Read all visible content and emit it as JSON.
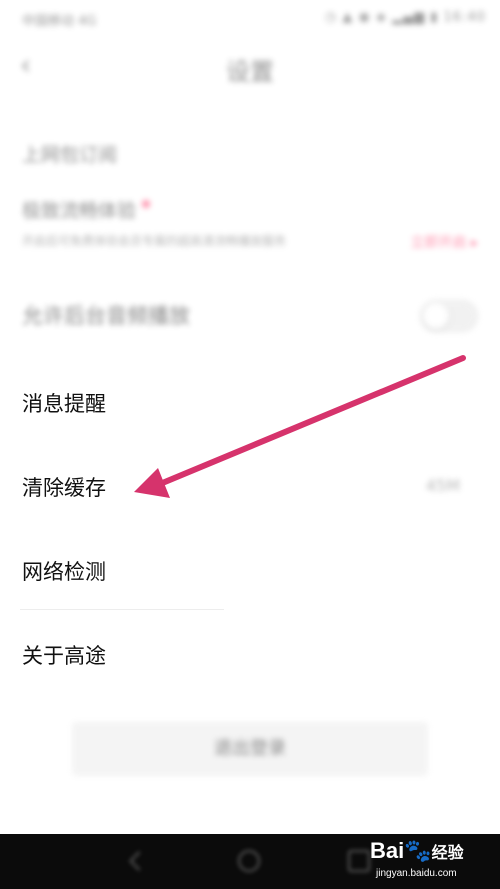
{
  "status_bar": {
    "carrier": "中国移动 4G",
    "icons": "◷ ▲ ◉ ◈ ▂▄▆ ▮ 16:40"
  },
  "nav": {
    "back_glyph": "‹",
    "title": "设置"
  },
  "settings": {
    "mobile_label": "上网包订阅",
    "trial_label": "极致流畅体验",
    "trial_desc": "开启后可免费体验会员专属的超高清流畅播放服务",
    "trial_link": "立即开启 ▸",
    "background_audio_label": "允许后台音频播放",
    "background_audio_on": false,
    "message_label": "消息提醒",
    "clear_cache_label": "清除缓存",
    "cache_size": "45M",
    "network_label": "网络检测",
    "about_label": "关于高途"
  },
  "logout_label": "退出登录",
  "watermark": {
    "brand": "Bai",
    "paw": "🐾",
    "brand_cn": "经验",
    "url": "jingyan.baidu.com"
  },
  "annotation": {
    "arrow_color": "#d6336c"
  }
}
